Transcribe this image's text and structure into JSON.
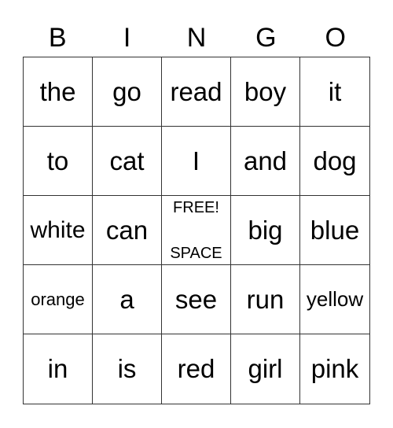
{
  "header": [
    "B",
    "I",
    "N",
    "G",
    "O"
  ],
  "cells": [
    {
      "text": "the"
    },
    {
      "text": "go"
    },
    {
      "text": "read"
    },
    {
      "text": "boy"
    },
    {
      "text": "it"
    },
    {
      "text": "to"
    },
    {
      "text": "cat"
    },
    {
      "text": "I"
    },
    {
      "text": "and"
    },
    {
      "text": "dog"
    },
    {
      "text": "white",
      "size": 30
    },
    {
      "text": "can"
    },
    {
      "free": true,
      "line1": "FREE!",
      "line2": "SPACE"
    },
    {
      "text": "big"
    },
    {
      "text": "blue"
    },
    {
      "text": "orange",
      "size": 22
    },
    {
      "text": "a"
    },
    {
      "text": "see"
    },
    {
      "text": "run"
    },
    {
      "text": "yellow",
      "size": 26
    },
    {
      "text": "in"
    },
    {
      "text": "is"
    },
    {
      "text": "red"
    },
    {
      "text": "girl"
    },
    {
      "text": "pink"
    }
  ]
}
